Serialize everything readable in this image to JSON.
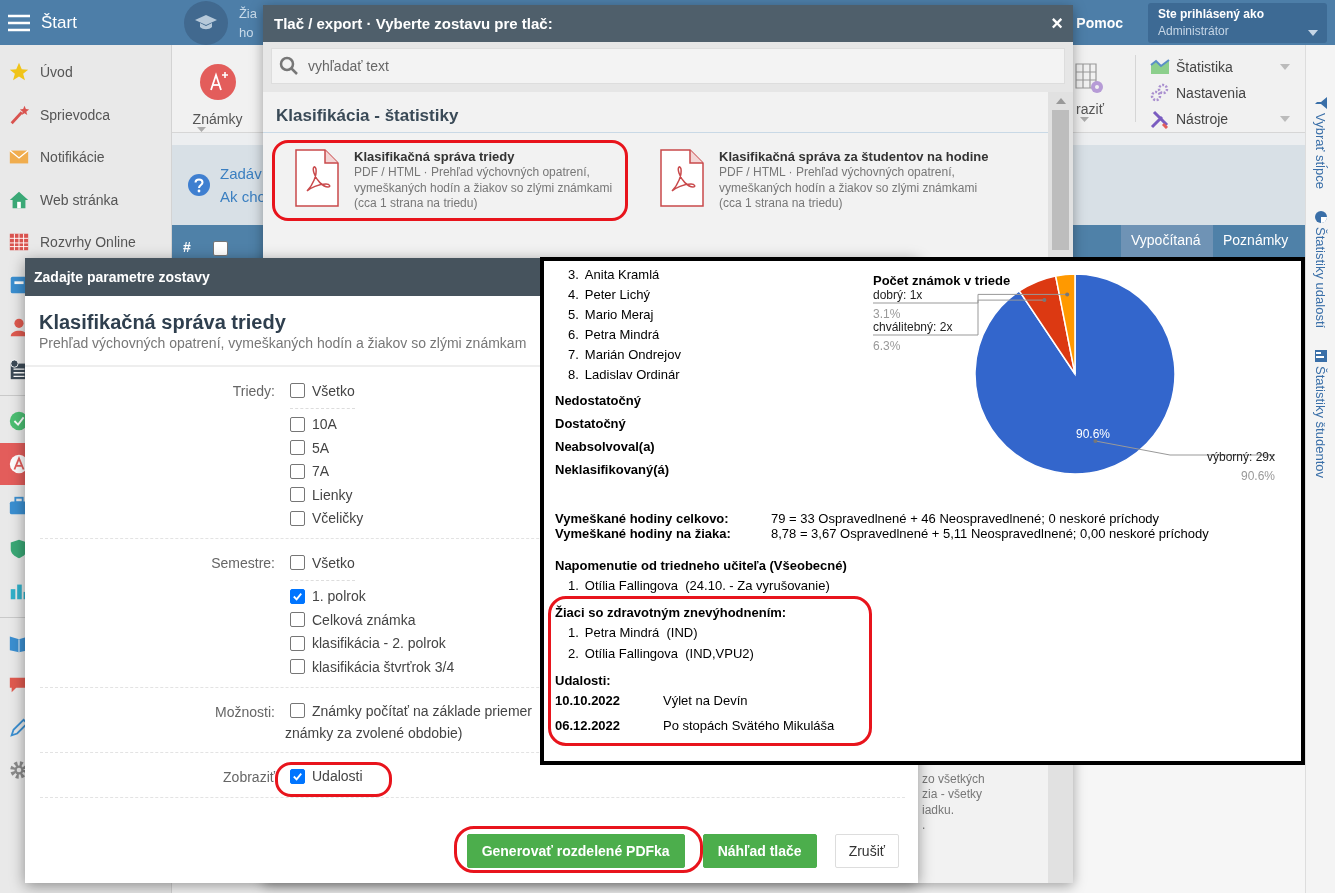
{
  "app": {
    "title": "Štart",
    "context_lines": [
      "Žia",
      "ho"
    ],
    "help": "Pomoc",
    "login": {
      "caption": "Ste prihlásený ako",
      "user": "Administrátor"
    },
    "sidebar": {
      "groups": [
        {
          "items": [
            {
              "label": "Úvod",
              "selected": false
            },
            {
              "label": "Sprievodca",
              "selected": false
            },
            {
              "label": "Notifikácie",
              "selected": false
            },
            {
              "label": "Web stránka",
              "selected": false
            },
            {
              "label": "Rozvrhy Online",
              "selected": false
            },
            {
              "selected": false
            },
            {
              "selected": false
            },
            {
              "selected": false
            }
          ]
        },
        {
          "items": [
            {
              "selected": false
            },
            {
              "selected": true
            },
            {
              "selected": false
            },
            {
              "selected": false
            },
            {
              "selected": false
            }
          ]
        },
        {
          "items": [
            {
              "selected": false
            },
            {
              "selected": false
            },
            {
              "selected": false
            },
            {
              "selected": false
            }
          ]
        }
      ]
    },
    "toolbar": {
      "grades": "Známky",
      "view": "raziť",
      "menu": [
        {
          "label": "Štatistika",
          "dropdown": true
        },
        {
          "label": "Nastavenia",
          "dropdown": false
        },
        {
          "label": "Nástroje",
          "dropdown": true
        }
      ]
    },
    "info": {
      "lines": [
        "Zadáv",
        "Ak cho"
      ]
    },
    "table_header": {
      "number": "#",
      "select_all": {
        "checked": false
      },
      "columns": [
        {
          "label": "Vypočítaná",
          "highlighted": true
        },
        {
          "label": "Poznámky",
          "highlighted": false
        }
      ]
    },
    "side_tabs": [
      "Vybrať stĺpce",
      "Štatistiky udalostí",
      "Štatistiky študentov"
    ]
  },
  "print_dialog": {
    "title": "Tlač / export · Vyberte zostavu pre tlač:",
    "close": "×",
    "search": {
      "placeholder": "vyhľadať text"
    },
    "section": "Klasifikácia - štatistiky",
    "reports": [
      {
        "title": "Klasifikačná správa triedy",
        "description": "PDF / HTML · Prehľad výchovných opatrení, vymeškaných hodín a žiakov so zlými známkami (cca 1 strana na triedu)",
        "highlighted": true
      },
      {
        "title": "Klasifikačná správa za študentov na hodine",
        "description": "PDF / HTML · Prehľad výchovných opatrení, vymeškaných hodín a žiakov so zlými známkami (cca 1 strana na triedu)",
        "highlighted": false
      }
    ],
    "partial_description": [
      "zo všetkých",
      "zia - všetky",
      "iadku.",
      "."
    ]
  },
  "params_dialog": {
    "title": "Zadajte parametre zostavy",
    "heading": "Klasifikačná správa triedy",
    "subtitle": "Prehľad výchovných opatrení, vymeškaných hodín a žiakov so zlými známkam",
    "groups": [
      {
        "label": "Triedy:",
        "highlighted": false,
        "all": {
          "label": "Všetko",
          "checked": false
        },
        "options": [
          {
            "label": "10A",
            "checked": false
          },
          {
            "label": "5A",
            "checked": false
          },
          {
            "label": "7A",
            "checked": false
          },
          {
            "label": "Lienky",
            "checked": false
          },
          {
            "label": "Včeličky",
            "checked": false
          }
        ]
      },
      {
        "label": "Semestre:",
        "highlighted": false,
        "all": {
          "label": "Všetko",
          "checked": false
        },
        "options": [
          {
            "label": "1. polrok",
            "checked": true
          },
          {
            "label": "Celková známka",
            "checked": false
          },
          {
            "label": "klasifikácia - 2. polrok",
            "checked": false
          },
          {
            "label": "klasifikácia štvrťrok 3/4",
            "checked": false
          }
        ]
      },
      {
        "label": "Možnosti:",
        "highlighted": false,
        "options": [
          {
            "label": "Známky počítať na základe priemer",
            "checked": false
          }
        ],
        "continuation": "známky za zvolené obdobie)"
      },
      {
        "label": "Zobraziť",
        "highlighted": true,
        "options": [
          {
            "label": "Udalosti",
            "checked": true
          }
        ]
      }
    ],
    "buttons": [
      {
        "label": "Generovať rozdelené PDFka",
        "kind": "primary",
        "highlighted": true
      },
      {
        "label": "Náhľad tlače",
        "kind": "primary",
        "highlighted": false
      },
      {
        "label": "Zrušiť",
        "kind": "default",
        "highlighted": false
      }
    ]
  },
  "report": {
    "students": [
      {
        "number": "3.",
        "name": "Anita Kramlá"
      },
      {
        "number": "4.",
        "name": "Peter Lichý"
      },
      {
        "number": "5.",
        "name": "Mario Meraj"
      },
      {
        "number": "6.",
        "name": "Petra Mindrá"
      },
      {
        "number": "7.",
        "name": "Marián Ondrejov"
      },
      {
        "number": "8.",
        "name": "Ladislav Ordinár"
      }
    ],
    "grade_headings": [
      "Nedostatočný",
      "Dostatočný",
      "Neabsolvoval(a)",
      "Neklasifikovaný(á)"
    ],
    "absences": [
      {
        "label": "Vymeškané hodiny celkovo:",
        "value": "79 = 33 Ospravedlnené + 46 Neospravedlnené; 0 neskoré príchody"
      },
      {
        "label": "Vymeškané hodiny na žiaka:",
        "value": "8,78 = 3,67 Ospravedlnené + 5,11 Neospravedlnené; 0,00 neskoré príchody"
      }
    ],
    "reprimand": {
      "heading": "Napomenutie od triedneho učiteľa (Všeobecné)",
      "items": [
        {
          "number": "1.",
          "text": "Otília Fallingova  (24.10. - Za vyrušovanie)"
        }
      ]
    },
    "notes_highlighted": true,
    "special_needs": {
      "heading": "Žiaci so zdravotným znevýhodnením:",
      "items": [
        {
          "number": "1.",
          "text": "Petra Mindrá  (IND)"
        },
        {
          "number": "2.",
          "text": "Otília Fallingova  (IND,VPU2)"
        }
      ]
    },
    "events": {
      "heading": "Udalosti:",
      "items": [
        {
          "date": "10.10.2022",
          "name": "Výlet na Devín"
        },
        {
          "date": "06.12.2022",
          "name": "Po stopách Svätého Mikuláša"
        }
      ]
    },
    "chart_data": {
      "type": "pie",
      "title": "Počet známok v triede",
      "categories": [
        "výborný: 29x",
        "chválitebný: 2x",
        "dobrý: 1x"
      ],
      "series": [
        {
          "values": [
            90.6,
            6.3,
            3.1
          ]
        }
      ],
      "colors": [
        "#3366cc",
        "#dc3912",
        "#ff9900"
      ],
      "value_labels": [
        "90.6%",
        "6.3%",
        "3.1%"
      ],
      "annotations": [
        {
          "text": "90.6%"
        }
      ]
    }
  }
}
